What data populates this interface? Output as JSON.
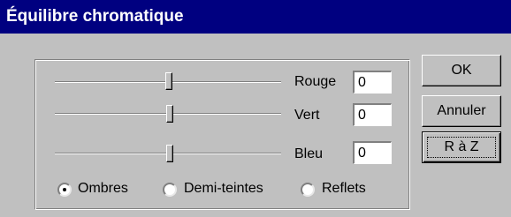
{
  "window": {
    "title": "Équilibre chromatique"
  },
  "sliders": [
    {
      "label": "Rouge",
      "value": "0"
    },
    {
      "label": "Vert",
      "value": "0"
    },
    {
      "label": "Bleu",
      "value": "0"
    }
  ],
  "tones": {
    "options": [
      "Ombres",
      "Demi-teintes",
      "Reflets"
    ],
    "selected": "Ombres"
  },
  "buttons": {
    "ok": "OK",
    "cancel": "Annuler",
    "reset": "R à Z"
  }
}
